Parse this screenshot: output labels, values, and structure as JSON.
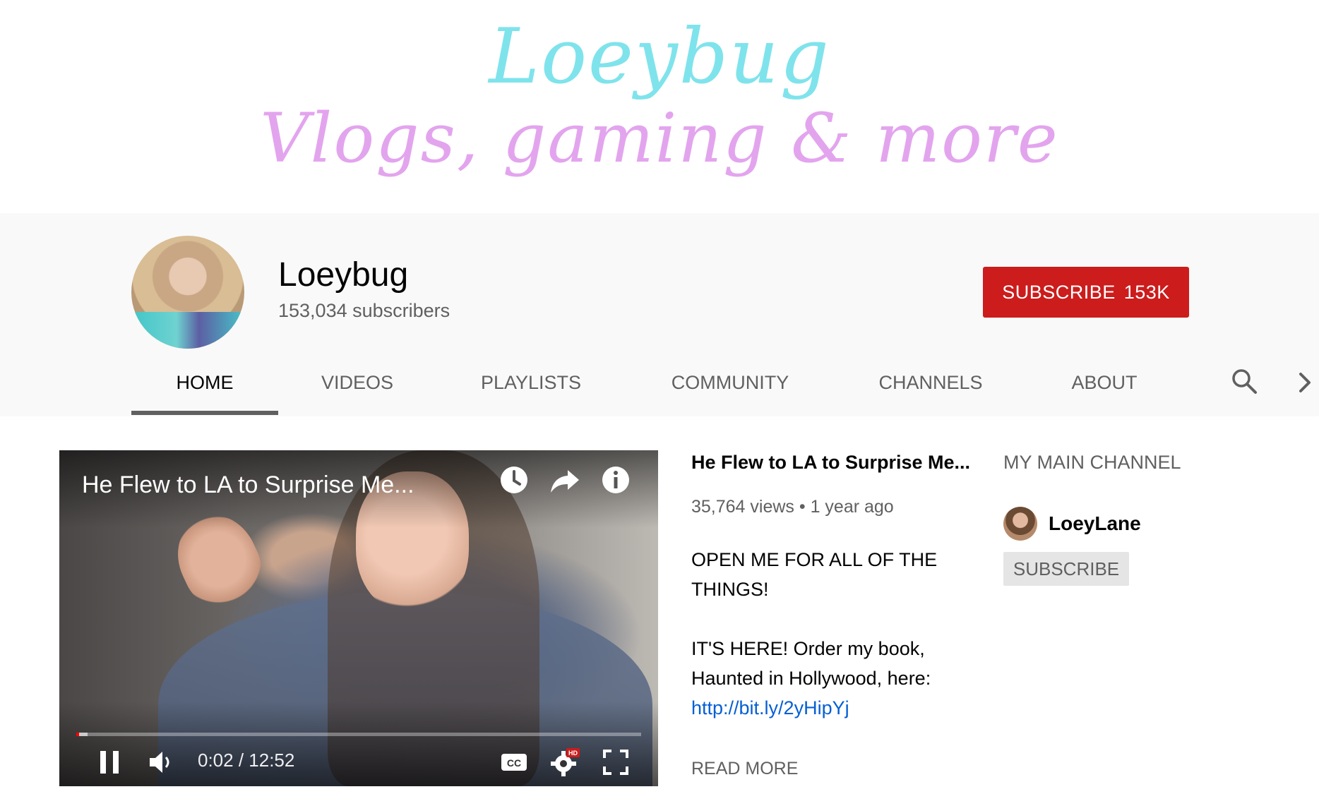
{
  "banner": {
    "line1": "Loeybug",
    "line2": "Vlogs, gaming & more"
  },
  "channel": {
    "name": "Loeybug",
    "subscribers": "153,034 subscribers",
    "subscribe_label": "SUBSCRIBE",
    "subscribe_count": "153K"
  },
  "tabs": [
    {
      "label": "HOME",
      "active": true
    },
    {
      "label": "VIDEOS"
    },
    {
      "label": "PLAYLISTS"
    },
    {
      "label": "COMMUNITY"
    },
    {
      "label": "CHANNELS"
    },
    {
      "label": "ABOUT"
    }
  ],
  "player": {
    "title": "He Flew to LA to Surprise Me...",
    "time": "0:02 / 12:52",
    "progress_played_fraction": 0.003,
    "progress_loaded_fraction": 0.02,
    "hd_badge": "HD",
    "cc_label": "CC"
  },
  "video": {
    "title": "He Flew to LA to Surprise Me...",
    "meta": "35,764 views • 1 year ago",
    "description_line1": "OPEN ME FOR ALL OF THE THINGS!",
    "description_line2": "IT'S HERE! Order my book, Haunted in Hollywood, here:",
    "link": "http://bit.ly/2yHipYj",
    "read_more": "READ MORE"
  },
  "featured": {
    "heading": "MY MAIN CHANNEL",
    "channel_name": "LoeyLane",
    "subscribe_label": "SUBSCRIBE"
  },
  "colors": {
    "subscribe_red": "#cc1c1c",
    "banner_cyan": "#7fe3ec",
    "banner_pink": "#e3a4ee",
    "link_blue": "#065fd4"
  }
}
